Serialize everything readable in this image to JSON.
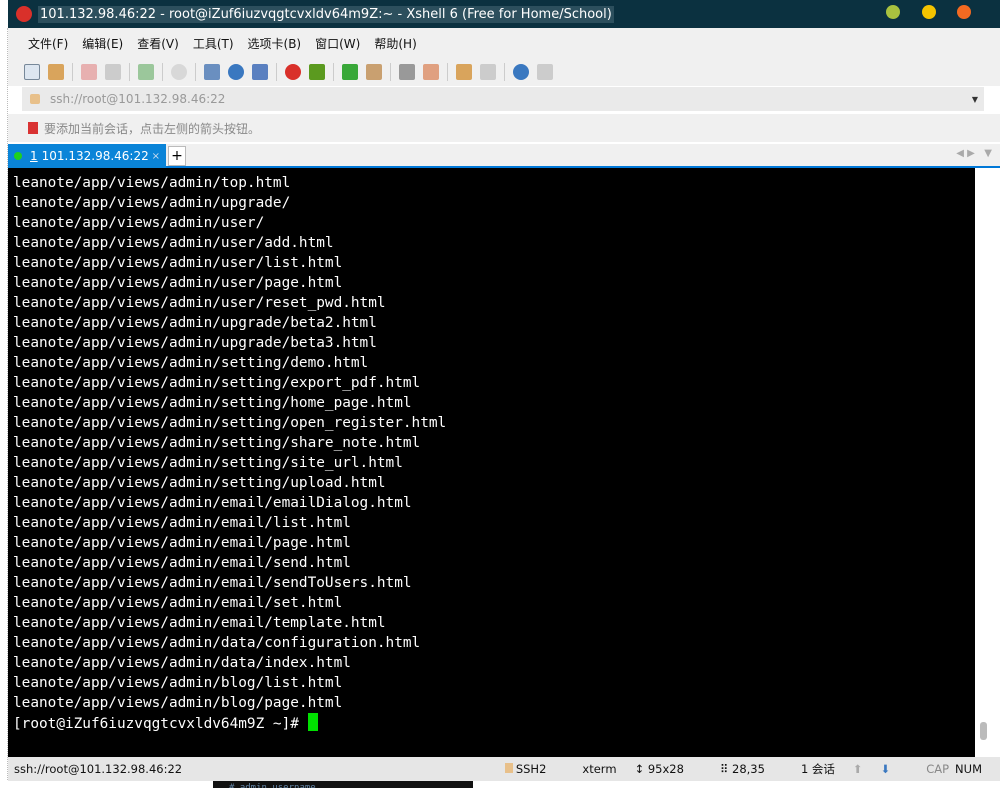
{
  "window": {
    "title": "101.132.98.46:22 - root@iZuf6iuzvqgtcvxldv64m9Z:~ - Xshell 6 (Free for Home/School)"
  },
  "menu": [
    "文件(F)",
    "编辑(E)",
    "查看(V)",
    "工具(T)",
    "选项卡(B)",
    "窗口(W)",
    "帮助(H)"
  ],
  "address": {
    "value": "ssh://root@101.132.98.46:22"
  },
  "hint": "要添加当前会话，点击左侧的箭头按钮。",
  "tab": {
    "number": "1",
    "label": "101.132.98.46:22",
    "close": "×",
    "add": "+"
  },
  "terminal": {
    "lines": [
      "leanote/app/views/admin/top.html",
      "leanote/app/views/admin/upgrade/",
      "leanote/app/views/admin/user/",
      "leanote/app/views/admin/user/add.html",
      "leanote/app/views/admin/user/list.html",
      "leanote/app/views/admin/user/page.html",
      "leanote/app/views/admin/user/reset_pwd.html",
      "leanote/app/views/admin/upgrade/beta2.html",
      "leanote/app/views/admin/upgrade/beta3.html",
      "leanote/app/views/admin/setting/demo.html",
      "leanote/app/views/admin/setting/export_pdf.html",
      "leanote/app/views/admin/setting/home_page.html",
      "leanote/app/views/admin/setting/open_register.html",
      "leanote/app/views/admin/setting/share_note.html",
      "leanote/app/views/admin/setting/site_url.html",
      "leanote/app/views/admin/setting/upload.html",
      "leanote/app/views/admin/email/emailDialog.html",
      "leanote/app/views/admin/email/list.html",
      "leanote/app/views/admin/email/page.html",
      "leanote/app/views/admin/email/send.html",
      "leanote/app/views/admin/email/sendToUsers.html",
      "leanote/app/views/admin/email/set.html",
      "leanote/app/views/admin/email/template.html",
      "leanote/app/views/admin/data/configuration.html",
      "leanote/app/views/admin/data/index.html",
      "leanote/app/views/admin/blog/list.html",
      "leanote/app/views/admin/blog/page.html"
    ],
    "prompt": "[root@iZuf6iuzvqgtcvxldv64m9Z ~]# "
  },
  "status": {
    "connection": "ssh://root@101.132.98.46:22",
    "protocol": "SSH2",
    "term": "xterm",
    "size": "95x28",
    "cursor": "28,35",
    "sessions": "1 会话",
    "cap": "CAP",
    "num": "NUM"
  },
  "background_text": "# admin username",
  "colors": {
    "titlebar": "#0b3140",
    "tab": "#0a84d8",
    "cursor": "#00e000"
  }
}
